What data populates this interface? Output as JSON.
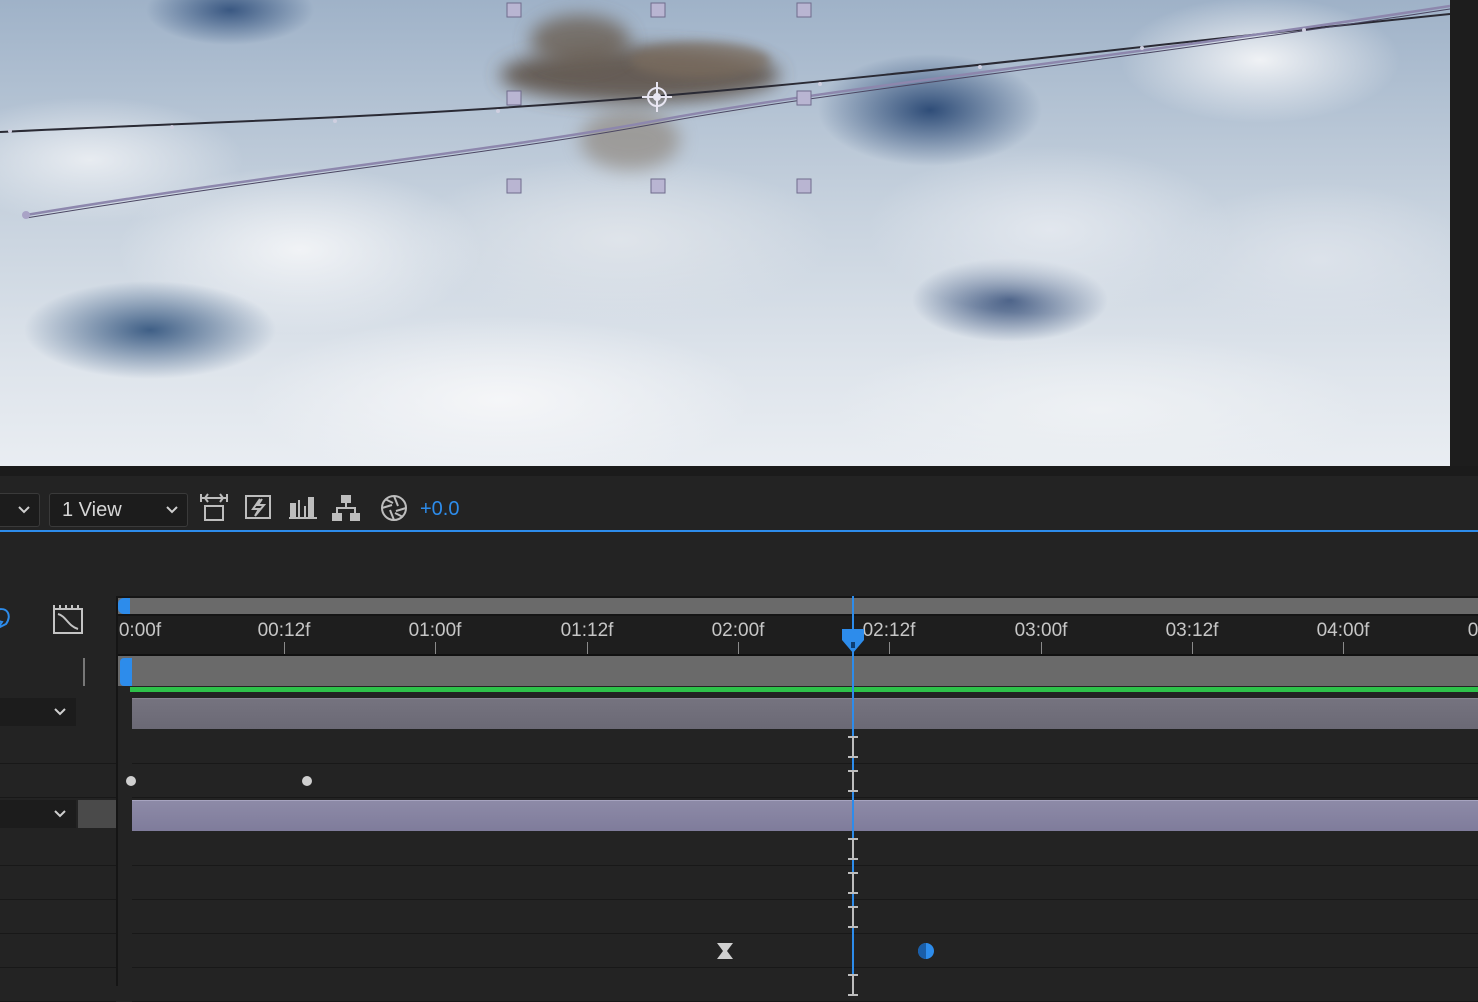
{
  "viewer": {
    "toolbar": {
      "left_dropdown_label": "",
      "view_dropdown_label": "1 View",
      "exposure_value": "+0.0",
      "icons": [
        "fit-to-frame-icon",
        "fast-previews-icon",
        "flowchart-icon",
        "hierarchy-icon",
        "exposure-icon"
      ]
    }
  },
  "timeline": {
    "ruler_labels": [
      "0:00f",
      "00:12f",
      "01:00f",
      "01:12f",
      "02:00f",
      "02:12f",
      "03:00f",
      "03:12f",
      "04:00f",
      "0"
    ],
    "current_time_marker": "02:07f",
    "icons": [
      "graph-editor-icon",
      "shy-blob-icon",
      "collapse-chevron-icon"
    ],
    "layers": [
      {
        "expanded": true
      },
      {
        "expanded": true
      }
    ]
  },
  "colors": {
    "accent": "#2d8ceb",
    "green_work": "#2ec24a",
    "layer_bar": "#8d8aa7"
  }
}
